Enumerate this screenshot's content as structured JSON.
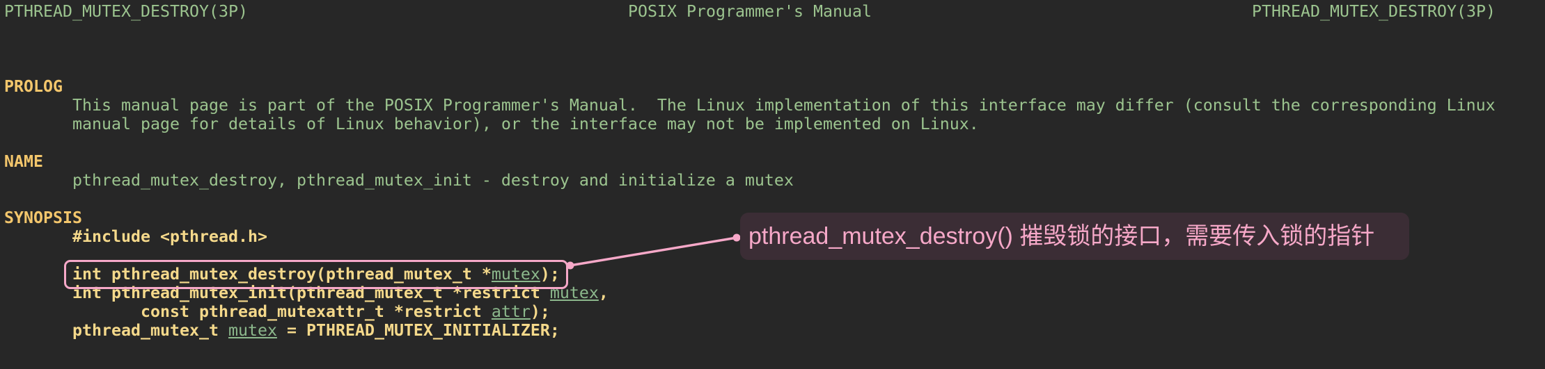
{
  "header": {
    "left": "PTHREAD_MUTEX_DESTROY(3P)",
    "center": "POSIX Programmer's Manual",
    "right": "PTHREAD_MUTEX_DESTROY(3P)"
  },
  "prolog": {
    "heading": "PROLOG",
    "lines": [
      "This manual page is part of the POSIX Programmer's Manual.  The Linux implementation of this interface may differ (consult the corresponding Linux",
      "manual page for details of Linux behavior), or the interface may not be implemented on Linux."
    ]
  },
  "name": {
    "heading": "NAME",
    "line": "pthread_mutex_destroy, pthread_mutex_init - destroy and initialize a mutex"
  },
  "synopsis": {
    "heading": "SYNOPSIS",
    "include": "#include <pthread.h>",
    "code": [
      {
        "before": "int pthread_mutex_destroy(pthread_mutex_t *",
        "arg": "mutex",
        "after": ");"
      },
      {
        "before": "int pthread_mutex_init(pthread_mutex_t *restrict ",
        "arg": "mutex",
        "after": ","
      },
      {
        "before": "       const pthread_mutexattr_t *restrict ",
        "arg": "attr",
        "after": ");"
      },
      {
        "before": "pthread_mutex_t ",
        "arg": "mutex",
        "after": " = PTHREAD_MUTEX_INITIALIZER;"
      }
    ]
  },
  "annotation": {
    "text": "pthread_mutex_destroy() 摧毁锁的接口，需要传入锁的指针"
  },
  "colors": {
    "background": "#272727",
    "text": "#9cc48f",
    "heading": "#f3c66c",
    "code": "#f5d98b",
    "argument": "#8cb88c",
    "annotation": "#f6a8c8",
    "annotation_bg": "#3b2d35"
  }
}
